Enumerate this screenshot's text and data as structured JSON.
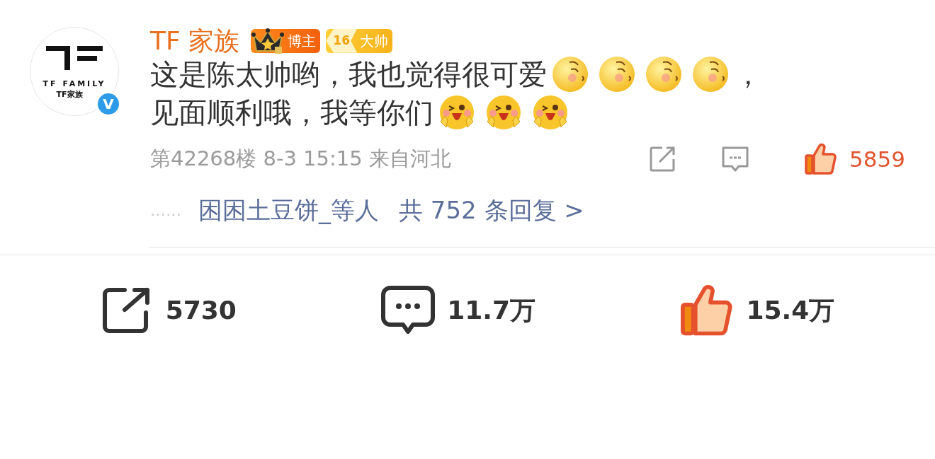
{
  "comment": {
    "avatar": {
      "brand": "TF FAMILY",
      "brand_cn": "TF家族",
      "verified_mark": "V"
    },
    "author": "TF 家族",
    "badges": [
      {
        "kind": "crown",
        "label": "博主"
      },
      {
        "kind": "level",
        "number": "16",
        "label": "大帅"
      }
    ],
    "lines": [
      [
        {
          "kind": "text",
          "text": "这是陈太帅哟，我也觉得很可爱"
        },
        {
          "kind": "shy"
        },
        {
          "kind": "shy"
        },
        {
          "kind": "shy"
        },
        {
          "kind": "shy"
        },
        {
          "kind": "text",
          "text": "，"
        }
      ],
      [
        {
          "kind": "text",
          "text": "见面顺利哦，我等你们"
        },
        {
          "kind": "cheer"
        },
        {
          "kind": "cheer"
        },
        {
          "kind": "cheer"
        }
      ]
    ],
    "meta": "第42268楼 8-3 15:15 来自河北",
    "like_count": "5859",
    "liked": true,
    "replies": {
      "dots": "……",
      "users": "困困土豆饼_等人",
      "total": "共 752 条回复 >"
    }
  },
  "actions": [
    {
      "kind": "share",
      "count": "5730"
    },
    {
      "kind": "comment",
      "count": "11.7万"
    },
    {
      "kind": "like",
      "count": "15.4万",
      "liked": true
    }
  ]
}
